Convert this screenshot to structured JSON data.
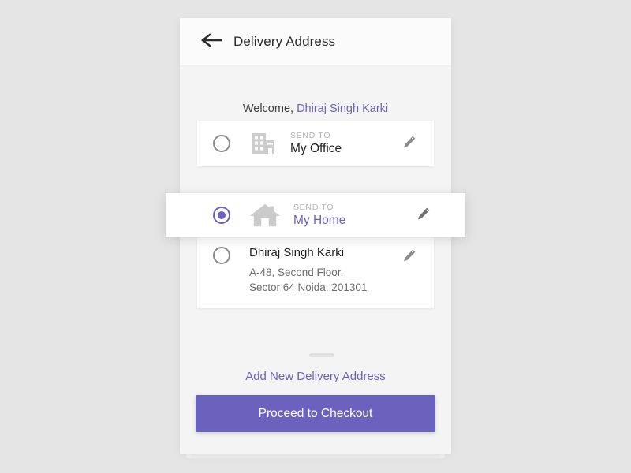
{
  "header": {
    "back_icon": "arrow-left-icon",
    "title": "Delivery Address"
  },
  "welcome": {
    "greeting": "Welcome, ",
    "user_name": "Dhiraj Singh Karki"
  },
  "addresses": [
    {
      "selected": false,
      "icon": "office-building-icon",
      "label": "SEND TO",
      "name": "My Office",
      "edit_icon": "pencil-icon"
    },
    {
      "selected": true,
      "icon": "home-icon",
      "label": "SEND TO",
      "name": "My Home",
      "edit_icon": "pencil-icon"
    },
    {
      "selected": false,
      "person_name": "Dhiraj Singh Karki",
      "address_line_1": "A-48, Second Floor,",
      "address_line_2": "Sector 64 Noida, 201301",
      "edit_icon": "pencil-icon"
    }
  ],
  "add_new_address_label": "Add New Delivery Address",
  "checkout_label": "Proceed to Checkout",
  "colors": {
    "accent": "#6a62bd",
    "page_background": "#e5e5e5",
    "screen_background": "#f4f4f4",
    "header_background": "#fbfbfb",
    "card_background": "#ffffff",
    "icon_gray": "#cccccc",
    "muted_text": "#b4b4b4"
  }
}
